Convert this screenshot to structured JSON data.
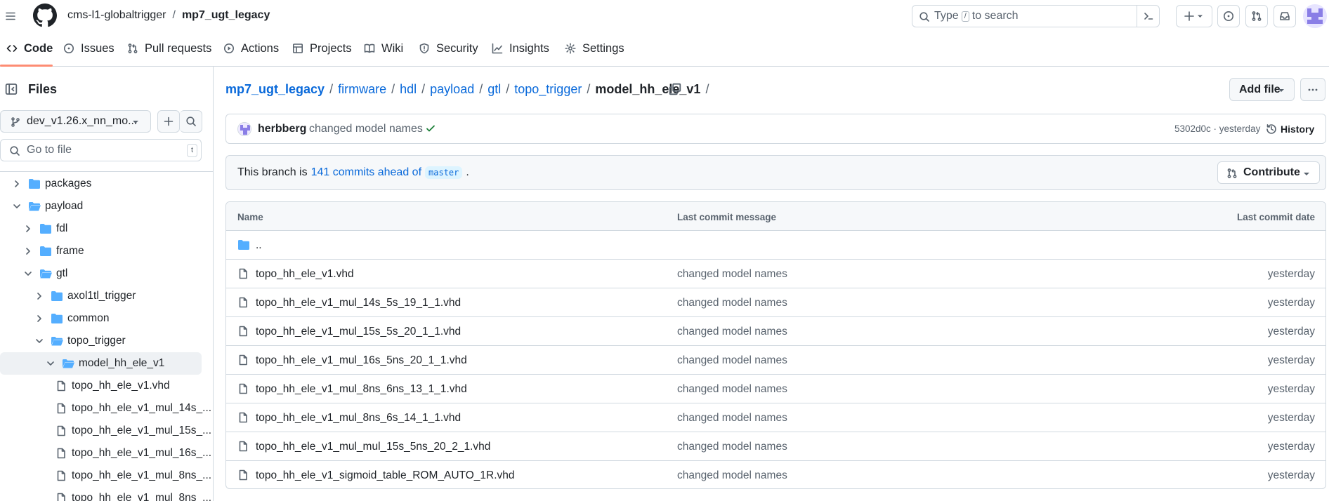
{
  "header": {
    "owner": "cms-l1-globaltrigger",
    "separator": "/",
    "repo": "mp7_ugt_legacy",
    "search_pre": "Type",
    "search_key": "/",
    "search_post": "to search"
  },
  "nav": {
    "tabs": [
      {
        "label": "Code",
        "icon": "code-icon"
      },
      {
        "label": "Issues",
        "icon": "issue-icon"
      },
      {
        "label": "Pull requests",
        "icon": "pull-request-icon"
      },
      {
        "label": "Actions",
        "icon": "play-icon"
      },
      {
        "label": "Projects",
        "icon": "table-icon"
      },
      {
        "label": "Wiki",
        "icon": "book-icon"
      },
      {
        "label": "Security",
        "icon": "shield-icon"
      },
      {
        "label": "Insights",
        "icon": "graph-icon"
      },
      {
        "label": "Settings",
        "icon": "gear-icon"
      }
    ]
  },
  "sidebar": {
    "title": "Files",
    "branch": "dev_v1.26.x_nn_mo...",
    "goto_placeholder": "Go to file",
    "goto_key": "t",
    "tree": [
      {
        "label": "packages",
        "type": "folder",
        "expanded": false
      },
      {
        "label": "payload",
        "type": "folder",
        "expanded": true
      },
      {
        "label": "fdl",
        "type": "folder",
        "expanded": false
      },
      {
        "label": "frame",
        "type": "folder",
        "expanded": false
      },
      {
        "label": "gtl",
        "type": "folder",
        "expanded": true
      },
      {
        "label": "axol1tl_trigger",
        "type": "folder",
        "expanded": false
      },
      {
        "label": "common",
        "type": "folder",
        "expanded": false
      },
      {
        "label": "topo_trigger",
        "type": "folder",
        "expanded": true
      },
      {
        "label": "model_hh_ele_v1",
        "type": "folder",
        "expanded": true,
        "selected": true
      },
      {
        "label": "topo_hh_ele_v1.vhd",
        "type": "file"
      },
      {
        "label": "topo_hh_ele_v1_mul_14s_...",
        "type": "file"
      },
      {
        "label": "topo_hh_ele_v1_mul_15s_...",
        "type": "file"
      },
      {
        "label": "topo_hh_ele_v1_mul_16s_...",
        "type": "file"
      },
      {
        "label": "topo_hh_ele_v1_mul_8ns_...",
        "type": "file"
      },
      {
        "label": "topo_hh_ele_v1_mul_8ns_...",
        "type": "file"
      }
    ]
  },
  "breadcrumb": {
    "repo": "mp7_ugt_legacy",
    "parts": [
      "firmware",
      "hdl",
      "payload",
      "gtl",
      "topo_trigger"
    ],
    "current": "model_hh_ele_v1",
    "separator": "/"
  },
  "actions": {
    "add_file": "Add file"
  },
  "commit": {
    "author": "herbberg",
    "message": "changed model names",
    "meta": "5302d0c · yesterday",
    "history": "History"
  },
  "branch_info": {
    "prefix": "This branch is",
    "ahead": "141 commits ahead of",
    "base": "master",
    "suffix": ".",
    "contribute": "Contribute"
  },
  "table": {
    "col_name": "Name",
    "col_message": "Last commit message",
    "col_date": "Last commit date",
    "parent": "..",
    "rows": [
      {
        "name": "topo_hh_ele_v1.vhd",
        "message": "changed model names",
        "date": "yesterday"
      },
      {
        "name": "topo_hh_ele_v1_mul_14s_5s_19_1_1.vhd",
        "message": "changed model names",
        "date": "yesterday"
      },
      {
        "name": "topo_hh_ele_v1_mul_15s_5s_20_1_1.vhd",
        "message": "changed model names",
        "date": "yesterday"
      },
      {
        "name": "topo_hh_ele_v1_mul_16s_5ns_20_1_1.vhd",
        "message": "changed model names",
        "date": "yesterday"
      },
      {
        "name": "topo_hh_ele_v1_mul_8ns_6ns_13_1_1.vhd",
        "message": "changed model names",
        "date": "yesterday"
      },
      {
        "name": "topo_hh_ele_v1_mul_8ns_6s_14_1_1.vhd",
        "message": "changed model names",
        "date": "yesterday"
      },
      {
        "name": "topo_hh_ele_v1_mul_mul_15s_5ns_20_2_1.vhd",
        "message": "changed model names",
        "date": "yesterday"
      },
      {
        "name": "topo_hh_ele_v1_sigmoid_table_ROM_AUTO_1R.vhd",
        "message": "changed model names",
        "date": "yesterday"
      }
    ]
  },
  "colors": {
    "link": "#0969da",
    "folder": "#54aeff",
    "success": "#1a7f37",
    "tab_underline": "#fd8c73",
    "border": "#d1d9e0"
  }
}
